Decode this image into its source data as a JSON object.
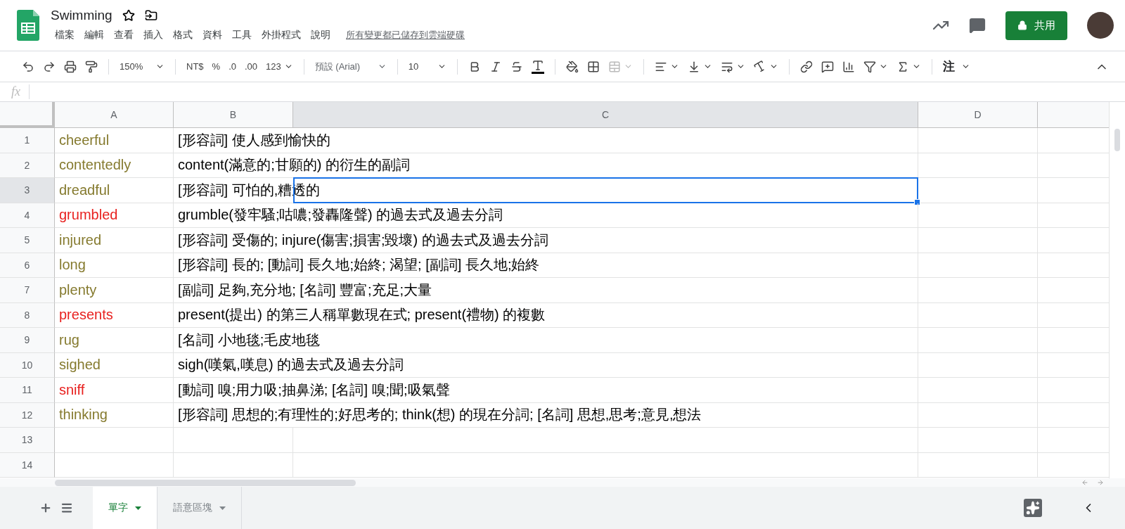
{
  "document": {
    "title": "Swimming",
    "save_status": "所有變更都已儲存到雲端硬碟"
  },
  "menu": [
    "檔案",
    "編輯",
    "查看",
    "插入",
    "格式",
    "資料",
    "工具",
    "外掛程式",
    "說明"
  ],
  "share_button": "共用",
  "toolbar": {
    "zoom": "150%",
    "currency": "NT$",
    "percent": "%",
    "decrease_decimals": ".0",
    "increase_decimals": ".00",
    "more_formats": "123",
    "font": "預設 (Arial)",
    "font_size": "10",
    "input_tools": "注"
  },
  "formula_bar": {
    "label": "fx"
  },
  "columns": [
    {
      "label": "A",
      "selected": false
    },
    {
      "label": "B",
      "selected": false
    },
    {
      "label": "C",
      "selected": true
    },
    {
      "label": "D",
      "selected": false
    }
  ],
  "rows": [
    {
      "number": "1",
      "selected": false,
      "word": "cheerful",
      "color": "#857a2e",
      "definition": "[形容詞] 使人感到愉快的"
    },
    {
      "number": "2",
      "selected": false,
      "word": "contentedly",
      "color": "#857a2e",
      "definition": "content(滿意的;甘願的) 的衍生的副詞"
    },
    {
      "number": "3",
      "selected": true,
      "word": "dreadful",
      "color": "#857a2e",
      "definition": "[形容詞] 可怕的,糟透的"
    },
    {
      "number": "4",
      "selected": false,
      "word": "grumbled",
      "color": "#e8211f",
      "definition": "grumble(發牢騷;咕噥;發轟隆聲) 的過去式及過去分詞"
    },
    {
      "number": "5",
      "selected": false,
      "word": "injured",
      "color": "#857a2e",
      "definition": "[形容詞] 受傷的; injure(傷害;損害;毀壞) 的過去式及過去分詞"
    },
    {
      "number": "6",
      "selected": false,
      "word": "long",
      "color": "#857a2e",
      "definition": "[形容詞] 長的; [動詞] 長久地;始終; 渴望; [副詞] 長久地;始終"
    },
    {
      "number": "7",
      "selected": false,
      "word": "plenty",
      "color": "#857a2e",
      "definition": "[副詞] 足夠,充分地; [名詞] 豐富;充足;大量"
    },
    {
      "number": "8",
      "selected": false,
      "word": "presents",
      "color": "#e8211f",
      "definition": "present(提出) 的第三人稱單數現在式; present(禮物) 的複數"
    },
    {
      "number": "9",
      "selected": false,
      "word": "rug",
      "color": "#857a2e",
      "definition": "[名詞] 小地毯;毛皮地毯"
    },
    {
      "number": "10",
      "selected": false,
      "word": "sighed",
      "color": "#857a2e",
      "definition": "sigh(嘆氣,嘆息) 的過去式及過去分詞"
    },
    {
      "number": "11",
      "selected": false,
      "word": "sniff",
      "color": "#e8211f",
      "definition": "[動詞] 嗅;用力吸;抽鼻涕; [名詞] 嗅;聞;吸氣聲"
    },
    {
      "number": "12",
      "selected": false,
      "word": "thinking",
      "color": "#857a2e",
      "definition": "[形容詞] 思想的;有理性的;好思考的; think(想) 的現在分詞; [名詞] 思想,思考;意見,想法"
    },
    {
      "number": "13",
      "selected": false
    },
    {
      "number": "14",
      "selected": false
    }
  ],
  "sheet_tabs": [
    {
      "label": "單字",
      "selected": true
    },
    {
      "label": "語意區塊",
      "selected": false
    }
  ]
}
